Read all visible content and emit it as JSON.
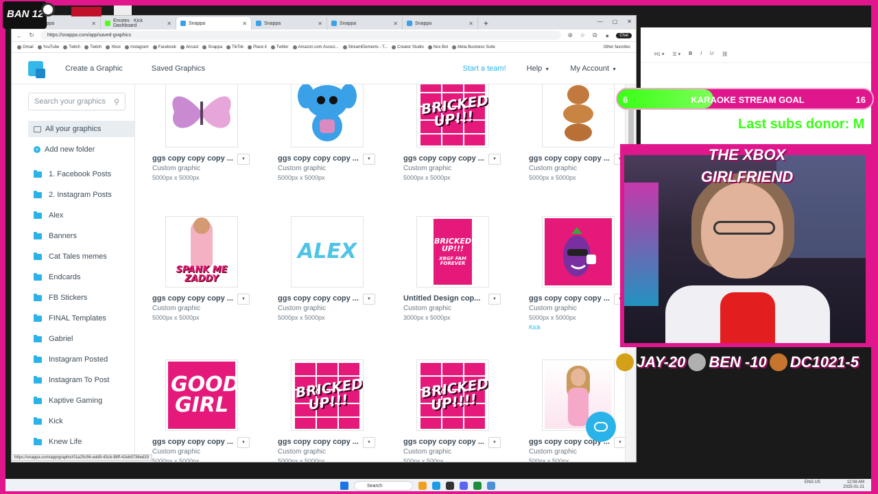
{
  "browser": {
    "tabs": [
      {
        "label": "Snappa",
        "icon": "snappa-icon",
        "active": false
      },
      {
        "label": "Emotes · Kick Dashboard",
        "icon": "kick-icon",
        "active": false
      },
      {
        "label": "Snappa",
        "icon": "snappa-icon",
        "active": true
      },
      {
        "label": "Snappa",
        "icon": "snappa-icon",
        "active": false
      },
      {
        "label": "Snappa",
        "icon": "snappa-icon",
        "active": false
      },
      {
        "label": "Snappa",
        "icon": "snappa-icon",
        "active": false
      }
    ],
    "url": "https://snappa.com/app/saved-graphics",
    "chat_label": "Chat",
    "bookmarks": [
      "Gmail",
      "YouTube",
      "Twitch",
      "Twitch",
      "Xbox",
      "Instagram",
      "Facebook",
      "Aircast",
      "Snappa",
      "TikTok",
      "Place it",
      "Twitter",
      "Amazon.com Associ...",
      "StreamElements - T...",
      "Creator Studio",
      "Nox Bot",
      "Meta Business Suite"
    ],
    "other_favorites": "Other favorites",
    "status_url": "https://snappa.com/app/graphic/01a25c56-edd9-43cb-98ff-42eb9736ed33"
  },
  "header": {
    "create": "Create a Graphic",
    "saved": "Saved Graphics",
    "start_team": "Start a team!",
    "help": "Help",
    "account": "My Account"
  },
  "sidebar": {
    "search_placeholder": "Search your graphics",
    "all": "All your graphics",
    "add_folder": "Add new folder",
    "folders": [
      "1. Facebook Posts",
      "2. Instagram Posts",
      "Alex",
      "Banners",
      "Cat Tales memes",
      "Endcards",
      "FB Stickers",
      "FINAL Templates",
      "Gabriel",
      "Instagram Posted",
      "Instagram To Post",
      "Kaptive Gaming",
      "Kick",
      "Knew Life"
    ]
  },
  "cards": [
    {
      "name": "ggs copy copy copy ...",
      "type": "Custom graphic",
      "size": "5000px x 5000px",
      "art": "butterfly"
    },
    {
      "name": "ggs copy copy copy ...",
      "type": "Custom graphic",
      "size": "5000px x 5000px",
      "art": "stitch"
    },
    {
      "name": "ggs copy copy copy ...",
      "type": "Custom graphic",
      "size": "5000px x 5000px",
      "art": "bricked-top",
      "text": "BRICKED UP!!!"
    },
    {
      "name": "ggs copy copy copy ...",
      "type": "Custom graphic",
      "size": "5000px x 5000px",
      "art": "capybara"
    },
    {
      "name": "ggs copy copy copy ...",
      "type": "Custom graphic",
      "size": "5000px x 5000px",
      "art": "spank",
      "text": "SPANK ME ZADDY"
    },
    {
      "name": "ggs copy copy copy ...",
      "type": "Custom graphic",
      "size": "5000px x 5000px",
      "art": "alex",
      "text": "ALEX"
    },
    {
      "name": "Untitled Design cop...",
      "type": "Custom graphic",
      "size": "3000px x 5000px",
      "art": "xbgf",
      "text": "BRICKED UP!!!",
      "subtext": "XBGF FAM FOREVER"
    },
    {
      "name": "ggs copy copy copy ...",
      "type": "Custom graphic",
      "size": "5000px x 5000px",
      "art": "eggplant",
      "tag": "Kick"
    },
    {
      "name": "ggs copy copy copy ...",
      "type": "Custom graphic",
      "size": "5000px x 5000px",
      "art": "goodgirl",
      "text": "GOOD GIRL"
    },
    {
      "name": "ggs copy copy copy ...",
      "type": "Custom graphic",
      "size": "5000px x 5000px",
      "art": "bricked",
      "text": "BRICKED UP!!!"
    },
    {
      "name": "ggs copy copy copy ...",
      "type": "Custom graphic",
      "size": "500px x 500px",
      "art": "bricked",
      "text": "BRICKED UP!!!!"
    },
    {
      "name": "ggs copy copy copy ...",
      "type": "Custom graphic",
      "size": "500px x 500px",
      "art": "girl"
    }
  ],
  "overlay": {
    "goal_current": "6",
    "goal_title": "KARAOKE STREAM GOAL",
    "goal_target": "16",
    "goal_progress": 0.375,
    "subs_donor": "Last subs donor: M",
    "streamer_name": "THE XBOX GIRLFRIEND",
    "leaderboard": [
      {
        "rank": "1",
        "text": "JAY-20"
      },
      {
        "rank": "2",
        "text": "BEN -10"
      },
      {
        "rank": "3",
        "text": "DC1021-5"
      }
    ],
    "brand_color": "#e0168c",
    "goal_color": "#39ff14"
  },
  "taskbar": {
    "search": "Search",
    "lang": "ENG\nUS",
    "time": "12:08 AM",
    "date": "2025-01-21"
  }
}
